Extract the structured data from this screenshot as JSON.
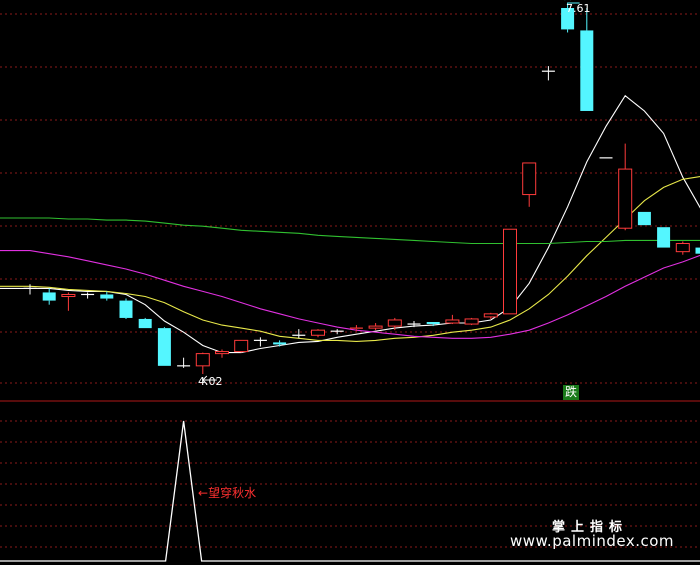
{
  "chart_data": {
    "type": "candlestick",
    "panel": "main",
    "annotations": {
      "max_label": "7.61",
      "min_label": "4.02",
      "signal_label": "跌",
      "indicator_label": "望穿秋水"
    },
    "watermark": {
      "title": "掌上指标",
      "url": "www.palmindex.com"
    },
    "colors": {
      "up": "#ff3b3b",
      "down": "#54f6ff",
      "flat": "#ffffff",
      "ma_white": "#ffffff",
      "ma_yellow": "#e8e84a",
      "ma_magenta": "#e030e0",
      "ma_green": "#30c030",
      "grid": "#8a1a1a",
      "indicator_line": "#ffffff"
    },
    "candles": [
      {
        "o": 4.86,
        "h": 4.9,
        "l": 4.8,
        "c": 4.86
      },
      {
        "o": 4.82,
        "h": 4.86,
        "l": 4.7,
        "c": 4.74
      },
      {
        "o": 4.78,
        "h": 4.82,
        "l": 4.64,
        "c": 4.8
      },
      {
        "o": 4.8,
        "h": 4.82,
        "l": 4.76,
        "c": 4.8
      },
      {
        "o": 4.8,
        "h": 4.83,
        "l": 4.74,
        "c": 4.76
      },
      {
        "o": 4.74,
        "h": 4.76,
        "l": 4.56,
        "c": 4.57
      },
      {
        "o": 4.56,
        "h": 4.57,
        "l": 4.47,
        "c": 4.47
      },
      {
        "o": 4.47,
        "h": 4.48,
        "l": 4.1,
        "c": 4.1
      },
      {
        "o": 4.1,
        "h": 4.18,
        "l": 4.08,
        "c": 4.1
      },
      {
        "o": 4.1,
        "h": 4.23,
        "l": 4.02,
        "c": 4.22
      },
      {
        "o": 4.22,
        "h": 4.26,
        "l": 4.18,
        "c": 4.24
      },
      {
        "o": 4.24,
        "h": 4.35,
        "l": 4.23,
        "c": 4.35
      },
      {
        "o": 4.35,
        "h": 4.38,
        "l": 4.29,
        "c": 4.35
      },
      {
        "o": 4.33,
        "h": 4.35,
        "l": 4.29,
        "c": 4.31
      },
      {
        "o": 4.4,
        "h": 4.46,
        "l": 4.37,
        "c": 4.4
      },
      {
        "o": 4.4,
        "h": 4.46,
        "l": 4.38,
        "c": 4.45
      },
      {
        "o": 4.44,
        "h": 4.46,
        "l": 4.41,
        "c": 4.44
      },
      {
        "o": 4.46,
        "h": 4.5,
        "l": 4.44,
        "c": 4.47
      },
      {
        "o": 4.47,
        "h": 4.52,
        "l": 4.45,
        "c": 4.49
      },
      {
        "o": 4.49,
        "h": 4.57,
        "l": 4.45,
        "c": 4.55
      },
      {
        "o": 4.51,
        "h": 4.54,
        "l": 4.48,
        "c": 4.51
      },
      {
        "o": 4.53,
        "h": 4.53,
        "l": 4.49,
        "c": 4.51
      },
      {
        "o": 4.52,
        "h": 4.6,
        "l": 4.51,
        "c": 4.55
      },
      {
        "o": 4.51,
        "h": 4.57,
        "l": 4.5,
        "c": 4.56
      },
      {
        "o": 4.58,
        "h": 4.62,
        "l": 4.56,
        "c": 4.61
      },
      {
        "o": 4.61,
        "h": 5.44,
        "l": 4.61,
        "c": 5.44
      },
      {
        "o": 5.78,
        "h": 6.09,
        "l": 5.66,
        "c": 6.09
      },
      {
        "o": 6.99,
        "h": 7.04,
        "l": 6.9,
        "c": 6.99
      },
      {
        "o": 7.61,
        "h": 7.61,
        "l": 7.37,
        "c": 7.4
      },
      {
        "o": 7.39,
        "h": 7.61,
        "l": 6.6,
        "c": 6.6
      },
      {
        "o": 6.14,
        "h": 6.14,
        "l": 6.14,
        "c": 6.14
      },
      {
        "o": 5.45,
        "h": 6.28,
        "l": 5.43,
        "c": 6.03
      },
      {
        "o": 5.61,
        "h": 5.61,
        "l": 5.48,
        "c": 5.48
      },
      {
        "o": 5.46,
        "h": 5.46,
        "l": 5.26,
        "c": 5.26
      },
      {
        "o": 5.22,
        "h": 5.32,
        "l": 5.19,
        "c": 5.3
      },
      {
        "o": 5.26,
        "h": 5.3,
        "l": 5.1,
        "c": 5.2
      },
      {
        "o": 5.12,
        "h": 5.23,
        "l": 5.06,
        "c": 5.19
      },
      {
        "o": 5.1,
        "h": 5.13,
        "l": 5.02,
        "c": 5.08
      }
    ],
    "ma": [
      {
        "name": "MA5",
        "color_key": "ma_white",
        "values": [
          4.86,
          4.86,
          4.84,
          4.83,
          4.83,
          4.8,
          4.7,
          4.54,
          4.43,
          4.3,
          4.23,
          4.23,
          4.27,
          4.3,
          4.33,
          4.34,
          4.38,
          4.41,
          4.44,
          4.47,
          4.49,
          4.5,
          4.52,
          4.52,
          4.55,
          4.67,
          4.91,
          5.26,
          5.66,
          6.1,
          6.45,
          6.75,
          6.6,
          6.38,
          5.95,
          5.62,
          5.4,
          5.26
        ]
      },
      {
        "name": "MA10",
        "color_key": "ma_yellow",
        "values": [
          4.88,
          4.87,
          4.85,
          4.84,
          4.83,
          4.81,
          4.78,
          4.72,
          4.63,
          4.55,
          4.5,
          4.47,
          4.44,
          4.39,
          4.37,
          4.35,
          4.35,
          4.34,
          4.35,
          4.37,
          4.38,
          4.4,
          4.43,
          4.45,
          4.48,
          4.55,
          4.66,
          4.8,
          4.98,
          5.18,
          5.36,
          5.54,
          5.72,
          5.85,
          5.93,
          5.96,
          5.92,
          5.82
        ]
      },
      {
        "name": "MA20",
        "color_key": "ma_magenta",
        "values": [
          5.23,
          5.2,
          5.17,
          5.13,
          5.09,
          5.05,
          5.0,
          4.94,
          4.88,
          4.83,
          4.78,
          4.72,
          4.66,
          4.61,
          4.56,
          4.52,
          4.48,
          4.45,
          4.43,
          4.41,
          4.39,
          4.38,
          4.37,
          4.37,
          4.38,
          4.41,
          4.45,
          4.52,
          4.6,
          4.69,
          4.78,
          4.88,
          4.97,
          5.06,
          5.12,
          5.19,
          5.25,
          5.3
        ]
      },
      {
        "name": "MA60",
        "color_key": "ma_green",
        "values": [
          5.55,
          5.55,
          5.54,
          5.54,
          5.53,
          5.53,
          5.52,
          5.5,
          5.48,
          5.47,
          5.45,
          5.43,
          5.42,
          5.41,
          5.4,
          5.38,
          5.37,
          5.36,
          5.35,
          5.34,
          5.33,
          5.32,
          5.31,
          5.3,
          5.3,
          5.3,
          5.3,
          5.3,
          5.31,
          5.32,
          5.32,
          5.33,
          5.33,
          5.33,
          5.33,
          5.33,
          5.32,
          5.32
        ]
      }
    ],
    "indicator": {
      "name": "望穿秋水",
      "values": [
        0,
        0,
        0,
        0,
        0,
        0,
        0,
        0,
        1,
        0,
        0,
        0,
        0,
        0,
        0,
        0,
        0,
        0,
        0,
        0,
        0,
        0,
        0,
        0,
        0,
        0,
        0,
        0,
        0,
        0,
        0,
        0,
        0,
        0,
        0,
        0,
        0,
        0
      ]
    }
  }
}
